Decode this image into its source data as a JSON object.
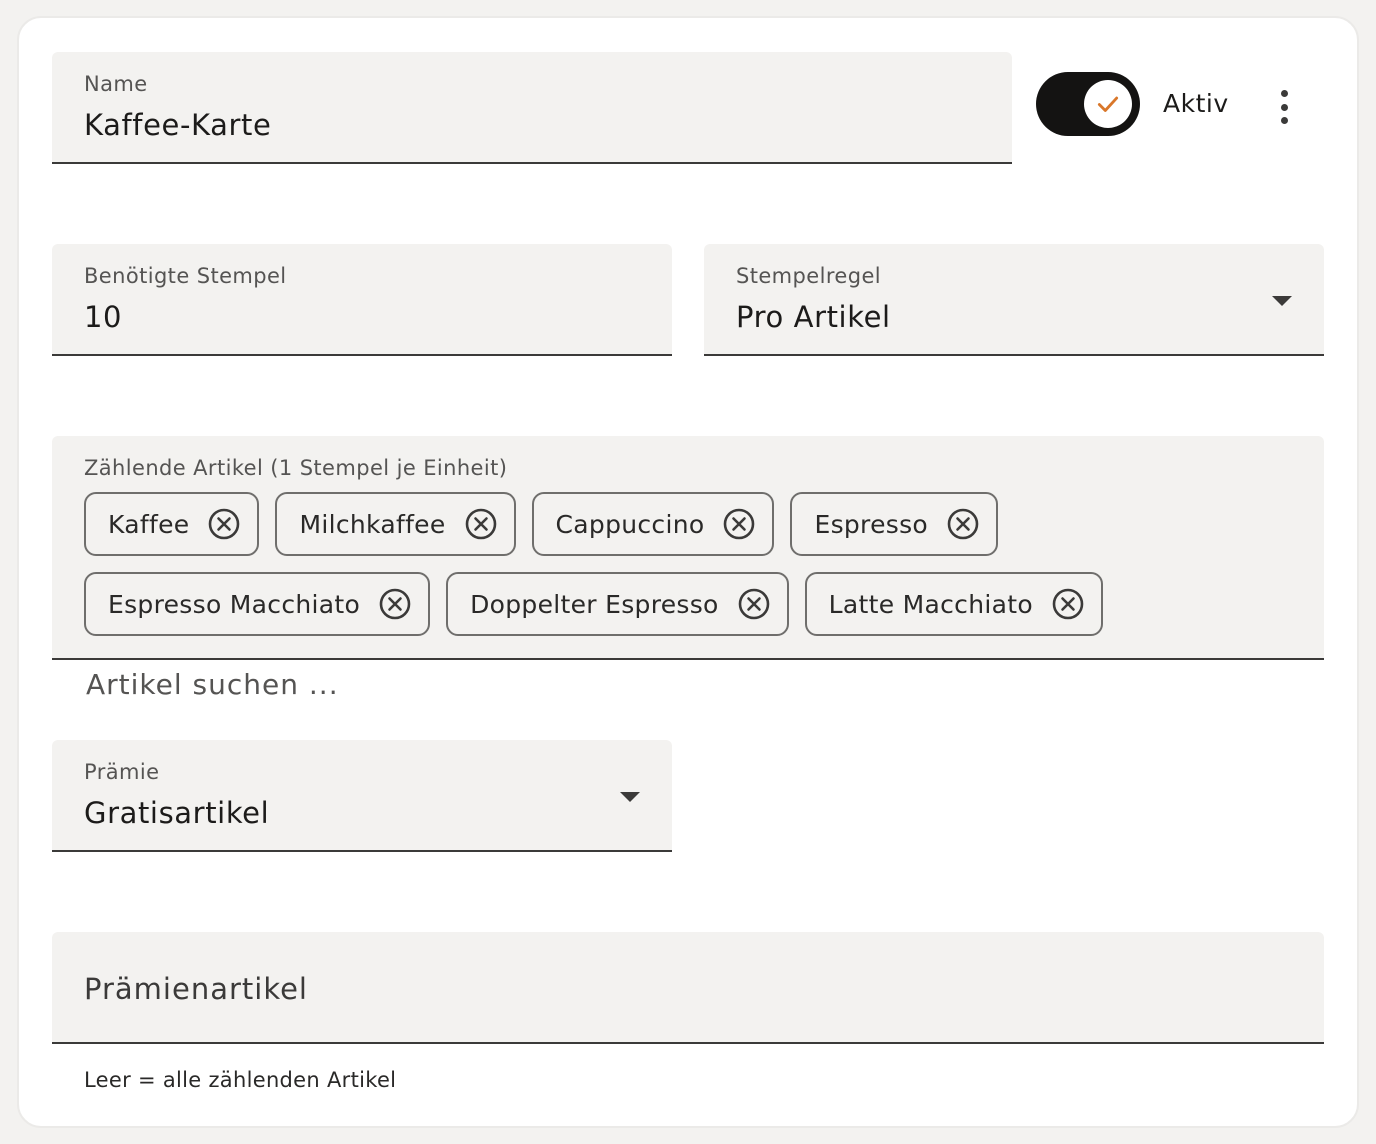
{
  "form": {
    "name": {
      "label": "Name",
      "value": "Kaffee-Karte"
    },
    "active": {
      "label": "Aktiv",
      "checked": true,
      "check_color": "#d9772a"
    },
    "more_icon": "more-vertical-icon",
    "stamps_needed": {
      "label": "Benötigte Stempel",
      "value": "10"
    },
    "stamp_rule": {
      "label": "Stempelregel",
      "selected": "Pro Artikel"
    },
    "counting_items": {
      "label": "Zählende Artikel (1 Stempel je Einheit)",
      "chips": [
        {
          "label": "Kaffee"
        },
        {
          "label": "Milchkaffee"
        },
        {
          "label": "Cappuccino"
        },
        {
          "label": "Espresso"
        },
        {
          "label": "Espresso Macchiato"
        },
        {
          "label": "Doppelter Espresso"
        },
        {
          "label": "Latte Macchiato"
        }
      ],
      "search_placeholder": "Artikel suchen ..."
    },
    "reward": {
      "label": "Prämie",
      "selected": "Gratisartikel"
    },
    "reward_items": {
      "placeholder": "Prämienartikel",
      "hint": "Leer = alle zählenden Artikel"
    }
  }
}
